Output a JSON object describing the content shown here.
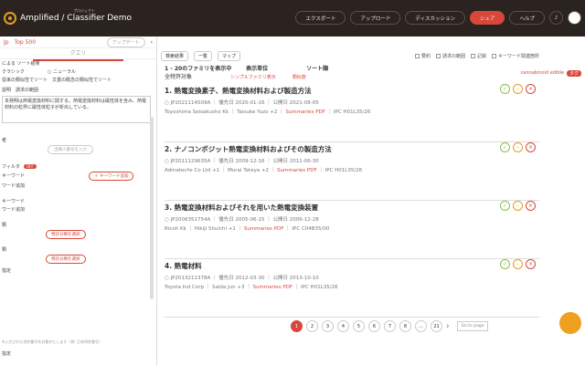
{
  "header": {
    "brand": "Amplified / Classifier Demo",
    "brand_sub": "プロジェクト",
    "buttons": [
      "エクスポート",
      "アップロード",
      "ディスカッション",
      "シェア",
      "ヘルプ"
    ]
  },
  "sidebar": {
    "tabs": [
      "Jp",
      "Top 500",
      "アップデート"
    ],
    "query_tab": "クエリ",
    "sort_title": "による ソート結果",
    "sort_options": [
      "クラシック",
      "ニューラル",
      "従来の類似性でソート",
      "文書の概念の類似性でソート"
    ],
    "fields": [
      "説明",
      "請求の範囲"
    ],
    "query_text": "本発明は熱電変換材料に関する。熱電変換材料は磁性体を含み、熱電材料の粒界に磁性体粒子が析出している。",
    "label_applicant": "者",
    "applicant_placeholder": "出願人番号を入力",
    "filter_label": "フィルタ",
    "filter_state": "OFF",
    "kw_label": "キーワード",
    "kw_add": "キーワード追加",
    "kw_add2": "ワード追加",
    "kw_button": "＋ キーワード追加",
    "kw_label2": "キーワード",
    "cpc_label": "類",
    "cpc_button": "特許分類を選択",
    "ipc_label": "類",
    "ipc_button": "特許分類を選択",
    "date_label": "指定",
    "footnote": "※入力された特許番号を対象外とします（例: 日本特許番号）",
    "last": "指定"
  },
  "toolbar": {
    "filter": "検索結果",
    "view_list": "一覧",
    "view_map": "マップ",
    "checks": [
      "要約",
      "請求の範囲",
      "記録",
      "キーワード関連箇所"
    ]
  },
  "info": {
    "range": "1 - 20のファミリを表示中",
    "unit_label": "表示単位",
    "unit_value": "シンプルファミリ表示",
    "sort_label": "ソート順",
    "sort_value": "類似度",
    "all": "全特許対象"
  },
  "tags": {
    "a": "cannabinoid edible",
    "b": "タグ"
  },
  "results": [
    {
      "title": "1. 熱電変換素子、熱電変換材料および製造方法",
      "id": "JP2021114509A",
      "priority": "優先日 2020-01-16",
      "pub": "公開日 2021-08-05",
      "owner": "Toyoshima Seisakusho Kk",
      "inventor": "Taisuke Yuzo +2",
      "summ": "Summaries",
      "pdf": "PDF",
      "ipc": "IPC H01L35/26"
    },
    {
      "title": "2. ナノコンポジット熱電変換材料およびその製造方法",
      "id": "JP2011129635A",
      "priority": "優先日 2009-12-16",
      "pub": "公開日 2011-06-30",
      "owner": "Admatechs Co Ltd +1",
      "inventor": "Murai Tateya +2",
      "summ": "Summaries",
      "pdf": "PDF",
      "ipc": "IPC H01L35/26"
    },
    {
      "title": "3. 熱電変換材料およびそれを用いた熱電変換装置",
      "id": "JP2006351754A",
      "priority": "優先日 2005-06-15",
      "pub": "公開日 2006-12-28",
      "owner": "Ricoh Kk",
      "inventor": "Hikiji Shuichi +1",
      "summ": "Summaries",
      "pdf": "PDF",
      "ipc": "IPC C04B35/00"
    },
    {
      "title": "4. 熱電材料",
      "id": "JP2013211378A",
      "priority": "優先日 2012-03-30",
      "pub": "公開日 2013-10-10",
      "owner": "Toyota Ind Corp",
      "inventor": "Saida Jun +3",
      "summ": "Summaries",
      "pdf": "PDF",
      "ipc": "IPC H01L35/26"
    }
  ],
  "pager": {
    "pages": [
      "1",
      "2",
      "3",
      "4",
      "5",
      "6",
      "7",
      "8",
      "...",
      "21"
    ],
    "goto": "Go to page"
  }
}
